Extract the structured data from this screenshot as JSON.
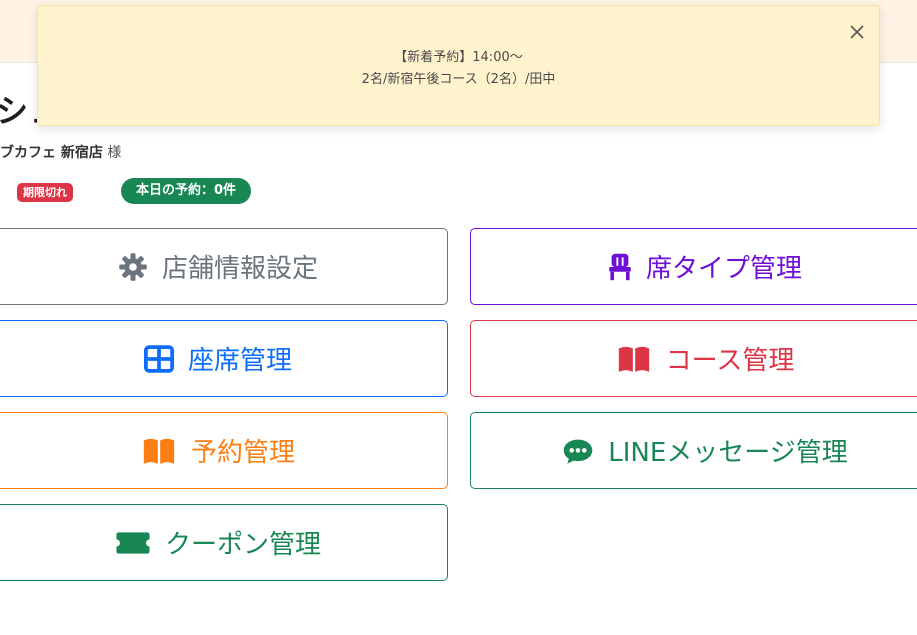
{
  "header": {
    "title": "シュ",
    "shop_name": "ブカフェ 新宿店",
    "shop_suffix": "様"
  },
  "status": {
    "expired_badge": "期限切れ",
    "today_reservations": "本日の予約：0件"
  },
  "menu": {
    "store_settings": {
      "label": "店舗情報設定",
      "icon": "gear-icon",
      "color": "#6c757d"
    },
    "seat_type": {
      "label": "席タイプ管理",
      "icon": "chair-icon",
      "color": "#6f0fd6"
    },
    "seat": {
      "label": "座席管理",
      "icon": "grid-icon",
      "color": "#0d6efd"
    },
    "course": {
      "label": "コース管理",
      "icon": "book-icon",
      "color": "#dc3545"
    },
    "reservation": {
      "label": "予約管理",
      "icon": "book-icon",
      "color": "#fd7e14"
    },
    "line_message": {
      "label": "LINEメッセージ管理",
      "icon": "chat-icon",
      "color": "#198754"
    },
    "coupon": {
      "label": "クーポン管理",
      "icon": "ticket-icon",
      "color": "#198754"
    }
  },
  "notification": {
    "line1": "【新着予約】14:00〜",
    "line2": "2名/新宿午後コース（2名）/田中",
    "close_icon": "close-icon"
  }
}
